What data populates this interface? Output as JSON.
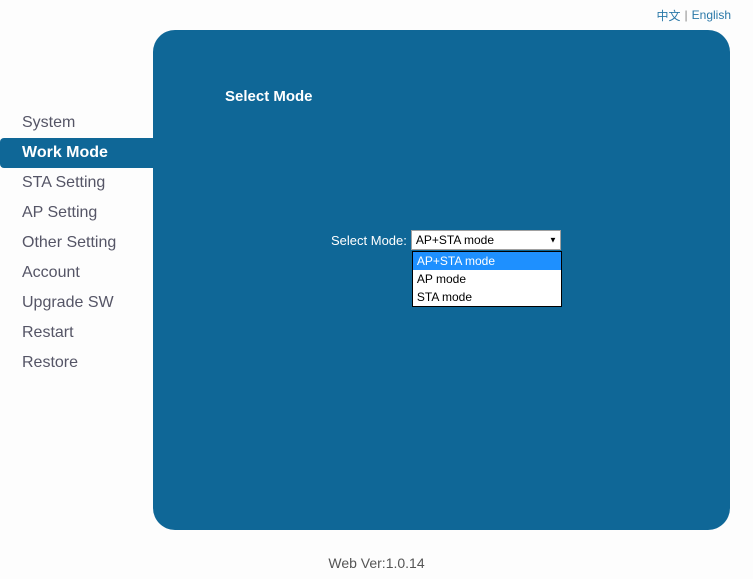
{
  "top": {
    "lang_alt": "中文",
    "lang_en": "English",
    "sep": "|"
  },
  "sidebar": {
    "items": [
      {
        "label": "System",
        "active": false
      },
      {
        "label": "Work Mode",
        "active": true
      },
      {
        "label": "STA Setting",
        "active": false
      },
      {
        "label": "AP Setting",
        "active": false
      },
      {
        "label": "Other Setting",
        "active": false
      },
      {
        "label": "Account",
        "active": false
      },
      {
        "label": "Upgrade SW",
        "active": false
      },
      {
        "label": "Restart",
        "active": false
      },
      {
        "label": "Restore",
        "active": false
      }
    ]
  },
  "panel": {
    "title": "Select Mode",
    "form": {
      "label": "Select Mode:",
      "selected": "AP+STA mode",
      "options": [
        {
          "label": "AP+STA mode",
          "highlight": true
        },
        {
          "label": "AP mode",
          "highlight": false
        },
        {
          "label": "STA mode",
          "highlight": false
        }
      ]
    }
  },
  "footer": {
    "version": "Web Ver:1.0.14"
  }
}
